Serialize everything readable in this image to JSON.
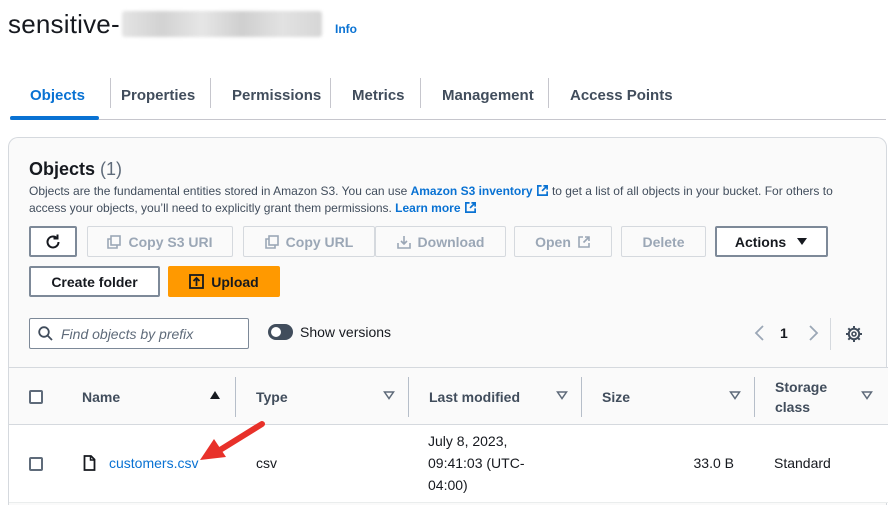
{
  "header": {
    "bucket_prefix": "sensitive-",
    "info": "Info"
  },
  "tabs": [
    {
      "label": "Objects"
    },
    {
      "label": "Properties"
    },
    {
      "label": "Permissions"
    },
    {
      "label": "Metrics"
    },
    {
      "label": "Management"
    },
    {
      "label": "Access Points"
    }
  ],
  "objects_panel": {
    "title": "Objects",
    "count": "(1)",
    "desc_part1": "Objects are the fundamental entities stored in Amazon S3. You can use ",
    "inventory_link": "Amazon S3 inventory",
    "desc_part2": " to get a list of all objects in your bucket. For others to access your objects, you’ll need to explicitly grant them permissions. ",
    "learn_more": "Learn more"
  },
  "toolbar": {
    "copy_s3_uri": "Copy S3 URI",
    "copy_url": "Copy URL",
    "download": "Download",
    "open": "Open",
    "delete": "Delete",
    "actions": "Actions",
    "create_folder": "Create folder",
    "upload": "Upload"
  },
  "search": {
    "placeholder": "Find objects by prefix"
  },
  "show_versions": "Show versions",
  "pagination": {
    "page": "1"
  },
  "table": {
    "columns": {
      "name": "Name",
      "type": "Type",
      "last_modified": "Last modified",
      "size": "Size",
      "storage_class_line1": "Storage",
      "storage_class_line2": "class"
    },
    "rows": [
      {
        "name": "customers.csv",
        "type": "csv",
        "last_modified_line1": "July 8, 2023,",
        "last_modified_line2": "09:41:03 (UTC-",
        "last_modified_line3": "04:00)",
        "size": "33.0 B",
        "storage_class": "Standard"
      }
    ]
  },
  "colors": {
    "accent": "#0972d3",
    "upload": "#ff9900",
    "arrow": "#e8312a"
  }
}
